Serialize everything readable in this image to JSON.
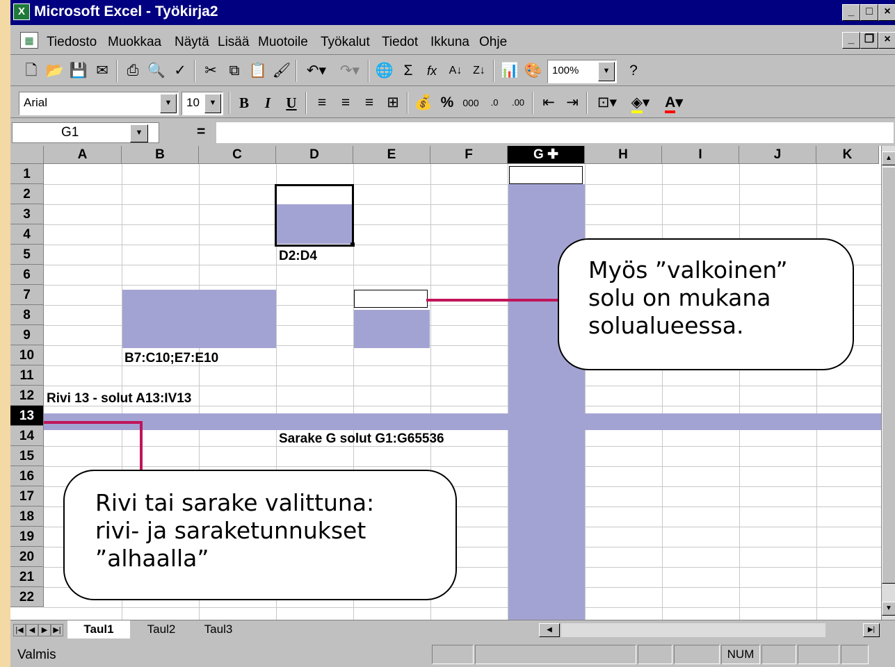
{
  "window": {
    "title": "Microsoft Excel - Työkirja2"
  },
  "menu": [
    "Tiedosto",
    "Muokkaa",
    "Näytä",
    "Lisää",
    "Muotoile",
    "Työkalut",
    "Tiedot",
    "Ikkuna",
    "Ohje"
  ],
  "toolbar": {
    "zoom": "100%"
  },
  "format_bar": {
    "font": "Arial",
    "size": "10"
  },
  "formula_bar": {
    "name_box": "G1",
    "equals": "="
  },
  "columns": [
    "A",
    "B",
    "C",
    "D",
    "E",
    "F",
    "G",
    "H",
    "I",
    "J",
    "K"
  ],
  "rows": [
    "1",
    "2",
    "3",
    "4",
    "5",
    "6",
    "7",
    "8",
    "9",
    "10",
    "11",
    "12",
    "13",
    "14",
    "15",
    "16",
    "17",
    "18",
    "19",
    "20",
    "21",
    "22"
  ],
  "cells": {
    "d2_label": "D2:D4",
    "b7_label": "B7:C10;E7:E10",
    "row12_label": "Rivi 13 - solut A13:IV13",
    "col_g_label": "Sarake G solut G1:G65536"
  },
  "callouts": {
    "white_cell": [
      "Myös ”valkoinen”",
      "solu on mukana",
      "solualueessa."
    ],
    "row_col": [
      "Rivi tai sarake valittuna:",
      "rivi- ja saraketunnukset",
      "”alhaalla”"
    ]
  },
  "sheet_tabs": [
    "Taul1",
    "Taul2",
    "Taul3"
  ],
  "status": {
    "ready": "Valmis",
    "num": "NUM"
  }
}
